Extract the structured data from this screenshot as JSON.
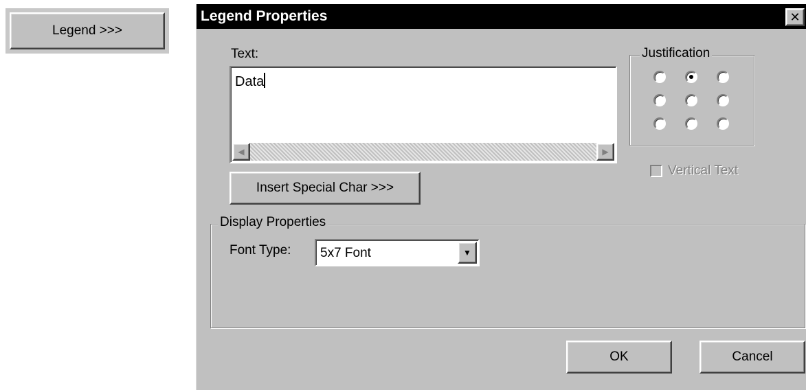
{
  "outer_button": {
    "label": "Legend >>>"
  },
  "dialog": {
    "title": "Legend Properties",
    "close_glyph": "✕",
    "text_label": "Text:",
    "text_value": "Data",
    "scroll_left_glyph": "◀",
    "scroll_right_glyph": "▶",
    "insert_special_label": "Insert Special Char >>>",
    "justification": {
      "label": "Justification",
      "selected": "top-center",
      "options": [
        "top-left",
        "top-center",
        "top-right",
        "middle-left",
        "middle-center",
        "middle-right",
        "bottom-left",
        "bottom-center",
        "bottom-right"
      ]
    },
    "vertical_text": {
      "label": "Vertical Text",
      "checked": false,
      "enabled": false
    },
    "display_properties": {
      "label": "Display Properties",
      "font_type_label": "Font Type:",
      "font_type_value": "5x7 Font",
      "dropdown_glyph": "▼"
    },
    "ok_label": "OK",
    "cancel_label": "Cancel"
  },
  "colors": {
    "face": "#c0c0c0",
    "titlebar": "#000000",
    "title_text": "#ffffff",
    "disabled_text": "#808080"
  }
}
